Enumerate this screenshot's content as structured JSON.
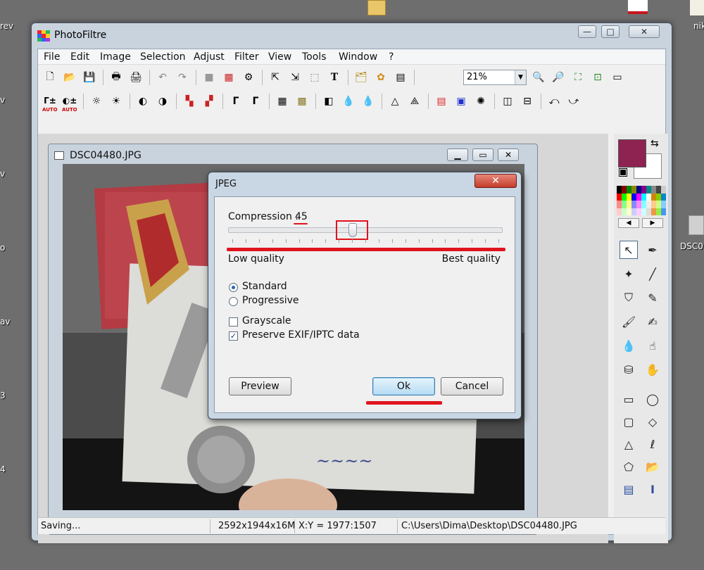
{
  "desktop": {
    "left_labels": [
      "rev",
      "v",
      "v",
      "o",
      "av",
      "3",
      "4"
    ],
    "right_labels": [
      "nik",
      "DSC0"
    ]
  },
  "window": {
    "title": "PhotoFiltre",
    "min_glyph": "—",
    "max_glyph": "□",
    "close_glyph": "✕"
  },
  "menu": [
    "File",
    "Edit",
    "Image",
    "Selection",
    "Adjust",
    "Filter",
    "View",
    "Tools",
    "Window",
    "?"
  ],
  "toolbar": {
    "zoom_value": "21%",
    "auto_label": "AUTO"
  },
  "document": {
    "title": "DSC04480.JPG"
  },
  "status": {
    "message": "Saving...",
    "image_size": "2592x1944x16M",
    "coords": "X:Y = 1977:1507",
    "path": "C:\\Users\\Dima\\Desktop\\DSC04480.JPG"
  },
  "colors": {
    "foreground": "#8e2352",
    "background": "#ffffff",
    "annotation_red": "#e0141e"
  },
  "dialog": {
    "title": "JPEG",
    "close_glyph": "✕",
    "compression_label": "Compression :",
    "compression_value": "45",
    "compression_fraction": 0.45,
    "low_label": "Low quality",
    "best_label": "Best quality",
    "radio_standard": "Standard",
    "radio_progressive": "Progressive",
    "selected_mode": "Standard",
    "check_grayscale": "Grayscale",
    "grayscale_checked": false,
    "check_exif": "Preserve EXIF/IPTC data",
    "exif_checked": true,
    "preview_button": "Preview",
    "ok_button": "Ok",
    "cancel_button": "Cancel"
  }
}
